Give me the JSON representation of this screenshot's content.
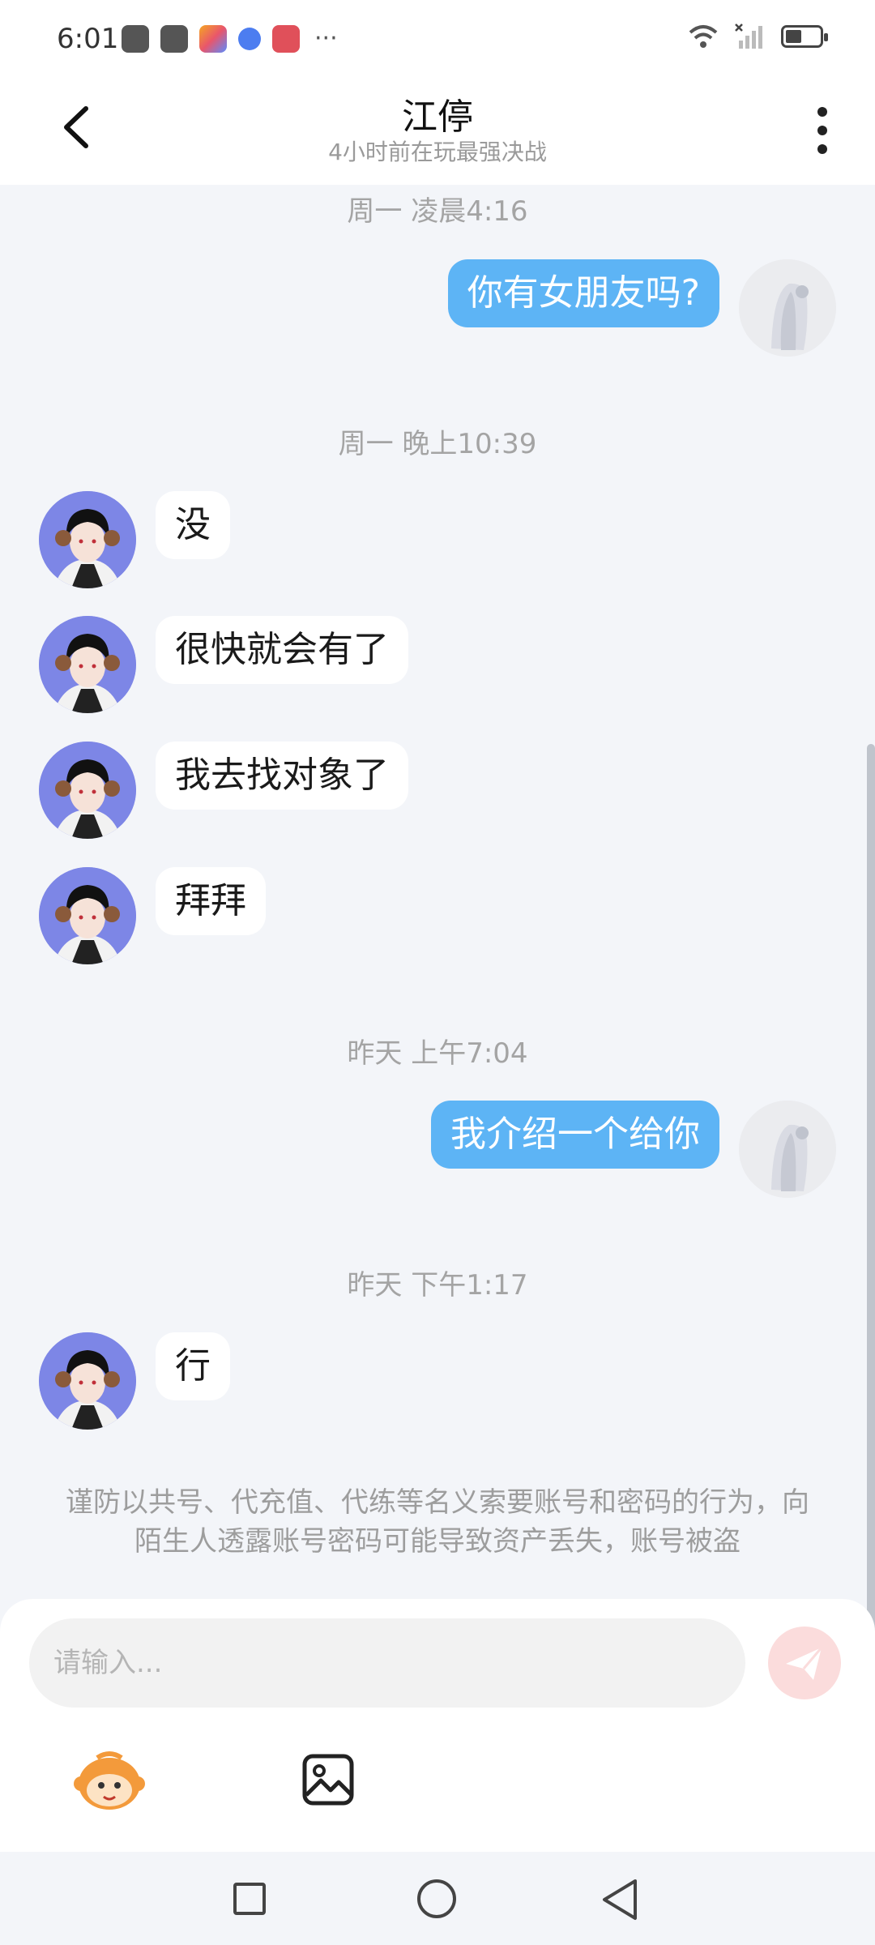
{
  "status_bar": {
    "time": "6:01",
    "more": "···"
  },
  "header": {
    "title": "江停",
    "subtitle": "4小时前在玩最强决战"
  },
  "messages": [
    {
      "type": "timestamp",
      "text": "周一 凌晨4:16"
    },
    {
      "type": "me",
      "text": "你有女朋友吗?"
    },
    {
      "type": "timestamp",
      "text": "周一 晚上10:39"
    },
    {
      "type": "other",
      "text": "没"
    },
    {
      "type": "other",
      "text": "很快就会有了"
    },
    {
      "type": "other",
      "text": "我去找对象了"
    },
    {
      "type": "other",
      "text": "拜拜"
    },
    {
      "type": "timestamp",
      "text": "昨天 上午7:04"
    },
    {
      "type": "me",
      "text": "我介绍一个给你"
    },
    {
      "type": "timestamp",
      "text": "昨天 下午1:17"
    },
    {
      "type": "other",
      "text": "行"
    }
  ],
  "warning": "谨防以共号、代充值、代练等名义索要账号和密码的行为，向陌生人透露账号密码可能导致资产丢失，账号被盗",
  "input": {
    "placeholder": "请输入..."
  },
  "colors": {
    "bubble_me": "#5db4f5",
    "bubble_other": "#ffffff",
    "send_button": "#fbdcdc",
    "background": "#f3f5f9"
  },
  "icons": {
    "back": "chevron-left-icon",
    "more": "more-vertical-icon",
    "send": "paper-plane-icon",
    "emoji": "monkey-emoji-icon",
    "image": "image-icon"
  }
}
